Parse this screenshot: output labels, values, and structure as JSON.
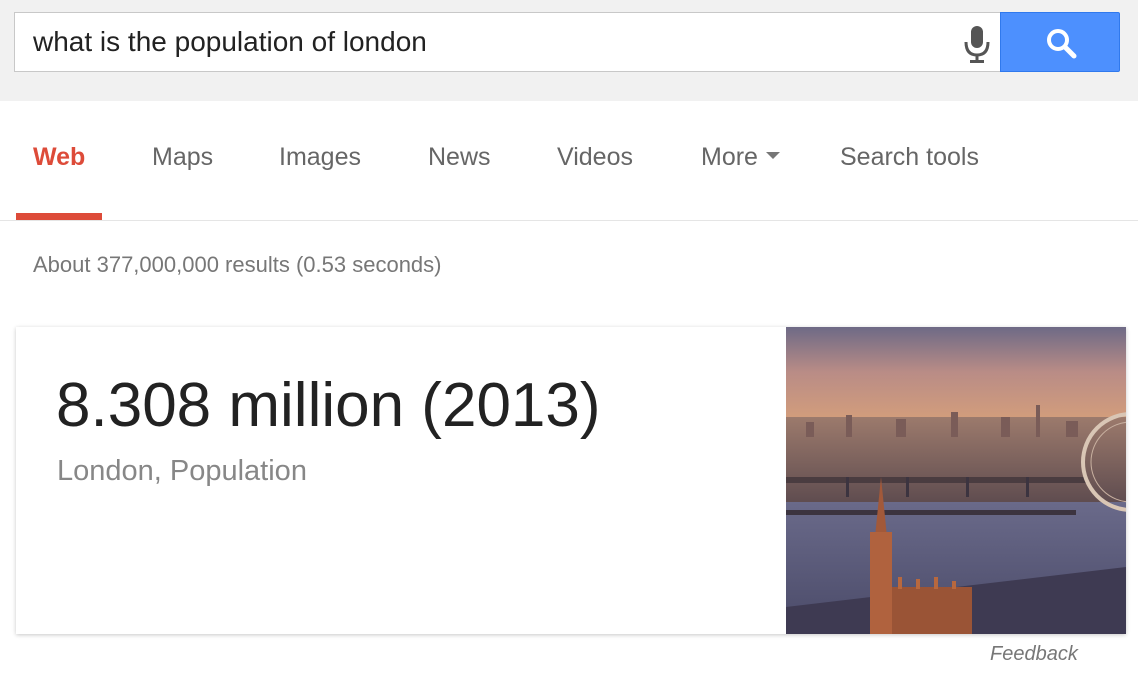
{
  "search": {
    "query": "what is the population of london",
    "mic_icon": "microphone-icon",
    "search_icon": "magnifier-icon",
    "button_color": "#4d90fe"
  },
  "tabs": [
    {
      "label": "Web",
      "active": true
    },
    {
      "label": "Maps"
    },
    {
      "label": "Images"
    },
    {
      "label": "News"
    },
    {
      "label": "Videos"
    },
    {
      "label": "More"
    },
    {
      "label": "Search tools"
    }
  ],
  "accent_color": "#dd4b39",
  "result_stats": "About 377,000,000 results (0.53 seconds)",
  "answer": {
    "value": "8.308 million (2013)",
    "subtitle": "London, Population"
  },
  "feedback_label": "Feedback"
}
